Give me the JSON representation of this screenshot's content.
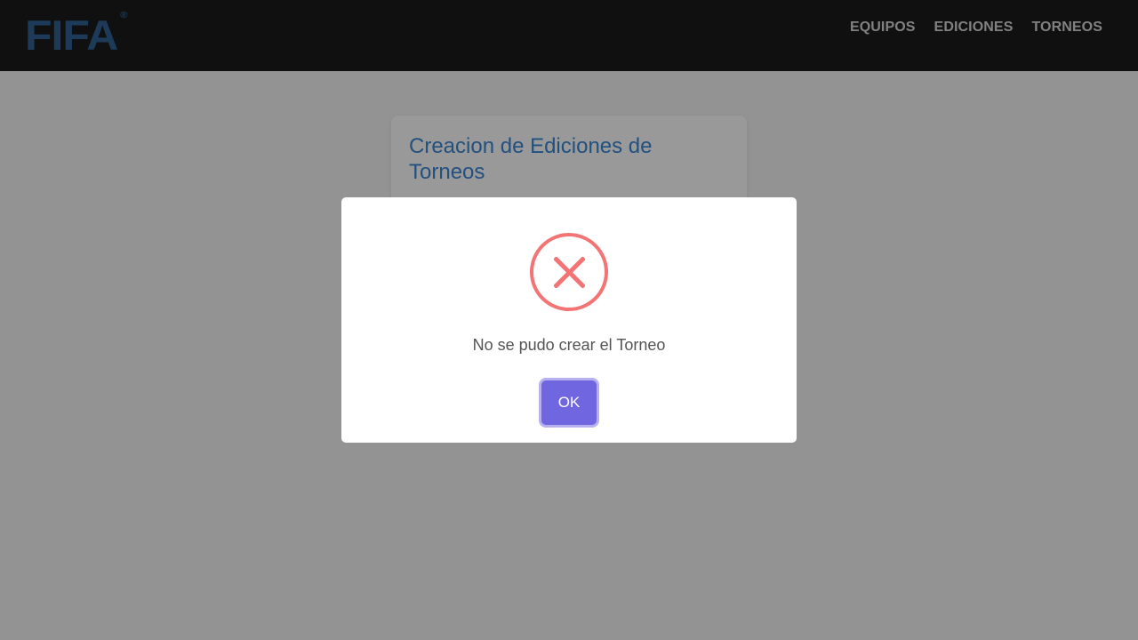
{
  "header": {
    "logo_text": "FIFA",
    "logo_mark": "®",
    "nav": [
      {
        "label": "EQUIPOS"
      },
      {
        "label": "EDICIONES"
      },
      {
        "label": "TORNEOS"
      }
    ]
  },
  "card": {
    "title": "Creacion de Ediciones de Torneos"
  },
  "modal": {
    "icon": "error-x-icon",
    "message": "No se pudo crear el Torneo",
    "ok_label": "OK"
  },
  "colors": {
    "navbar_bg": "#1c1c1c",
    "logo": "#326295",
    "card_title": "#3a86d4",
    "error_icon": "#f27474",
    "ok_button": "#7066e0"
  }
}
